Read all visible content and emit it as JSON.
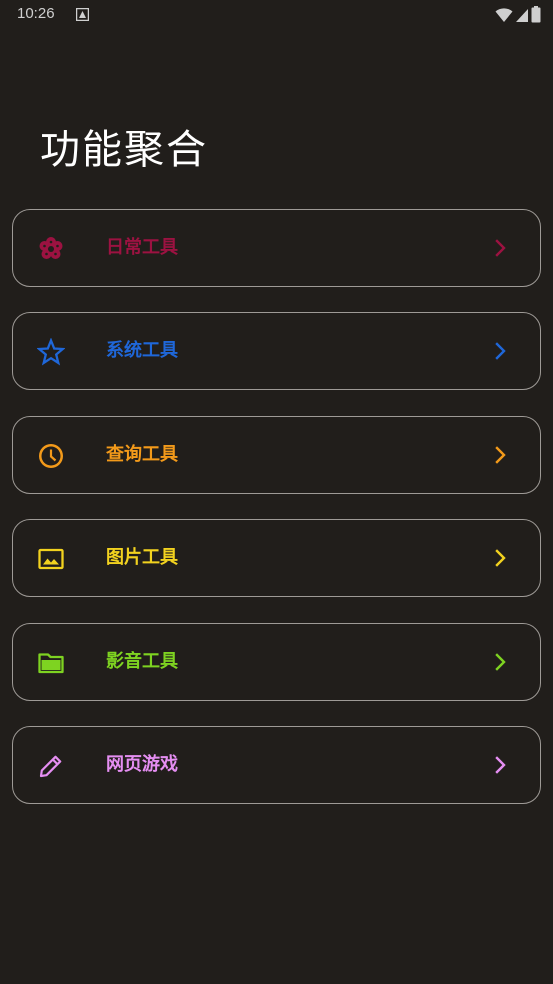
{
  "status_bar": {
    "time": "10:26"
  },
  "page": {
    "title": "功能聚合"
  },
  "menu": {
    "items": [
      {
        "label": "日常工具",
        "icon": "flower-icon",
        "color": "#9c1241"
      },
      {
        "label": "系统工具",
        "icon": "star-icon",
        "color": "#1f67d9"
      },
      {
        "label": "查询工具",
        "icon": "clock-icon",
        "color": "#f39a1a"
      },
      {
        "label": "图片工具",
        "icon": "image-icon",
        "color": "#f2d21f"
      },
      {
        "label": "影音工具",
        "icon": "folder-icon",
        "color": "#7ed321"
      },
      {
        "label": "网页游戏",
        "icon": "pencil-icon",
        "color": "#e58ef2"
      }
    ]
  }
}
